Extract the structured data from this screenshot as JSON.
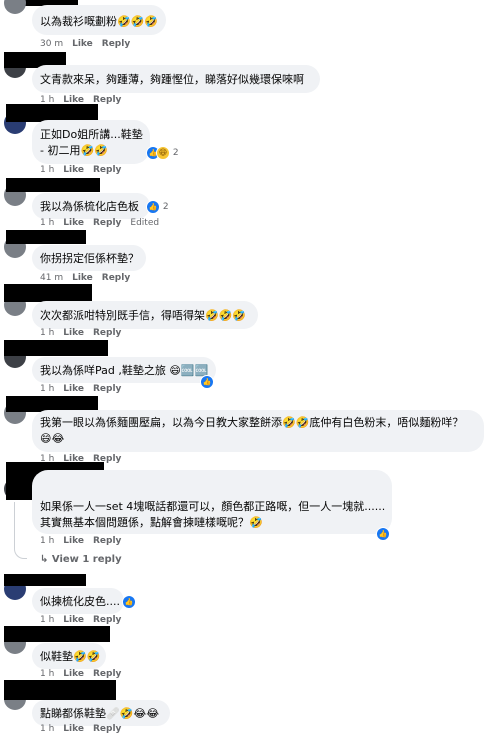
{
  "labels": {
    "like": "Like",
    "reply": "Reply",
    "edited": "Edited",
    "view_reply": "View 1 reply"
  },
  "comments": [
    {
      "text": [
        "以為裁衫嘅劃粉🤣🤣🤣"
      ],
      "time": "30 m"
    },
    {
      "text": [
        "文青款來呆，夠踵薄，夠踵慳位，睇落好似幾環保唻啊"
      ],
      "time": "1 h"
    },
    {
      "text": [
        "正如Do姐所講...鞋墊",
        "- 初二用🤣🤣"
      ],
      "time": "1 h",
      "reactions": "2"
    },
    {
      "text": [
        "我以為係梳化店色板"
      ],
      "time": "1 h",
      "reactions": "2",
      "edited": true
    },
    {
      "text": [
        "你拐拐定佢係杯墊？"
      ],
      "time": "41 m"
    },
    {
      "text": [
        "次次都派咁特別既手信，得唔得架🤣🤣🤣"
      ],
      "time": "1 h"
    },
    {
      "text": [
        "我以為係咩Pad ,鞋墊之旅 😄🆒🆒"
      ],
      "time": "1 h"
    },
    {
      "text": [
        "我第一眼以為係麵團壓扁，以為今日教大家整餅添🤣🤣底仲有白色粉末，唔似麵粉咩？",
        "😄😂"
      ],
      "time": "1 h"
    },
    {
      "text": [
        "如果係一人一set 4塊嘅話都還可以，顏色都正路嘅，但一人一塊就......",
        "其實無基本個問題係，點解會揀嗹樣嘅呢？🤣"
      ],
      "time": "1 h"
    },
    {
      "text": [
        "似揀梳化皮色...."
      ],
      "time": "1 h"
    },
    {
      "text": [
        "似鞋墊🤣🤣"
      ],
      "time": "1 h"
    },
    {
      "text": [
        "點睇都係鞋墊🩹🤣😂😂"
      ],
      "time": "1 h"
    }
  ]
}
